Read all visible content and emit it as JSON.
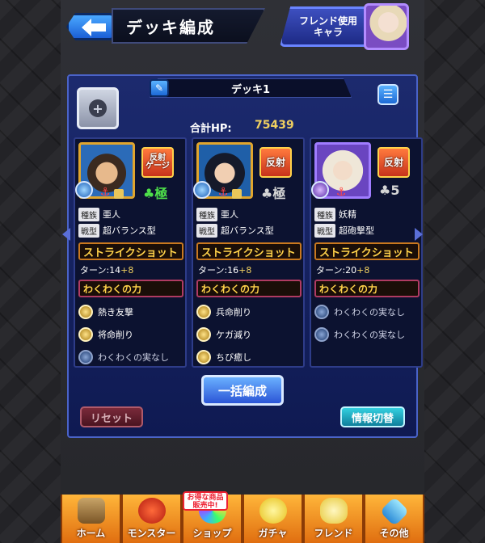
{
  "header": {
    "title": "デッキ編成",
    "friend_button_line1": "フレンド使用",
    "friend_button_line2": "キャラ"
  },
  "deck": {
    "name": "デッキ1",
    "total_hp_label": "合計HP:",
    "total_hp_value": "75439"
  },
  "cards": [
    {
      "ability_line1": "反射",
      "ability_line2": "ゲージ",
      "luck": "極",
      "tribe_tag": "種族",
      "tribe": "亜人",
      "type_tag": "戦型",
      "type": "超バランス型",
      "strike_shot": "ストライクショット",
      "turn_prefix": "ターン:14",
      "turn_plus": "+8",
      "waku_title": "わくわくの力",
      "gauges": [
        "熱き友撃",
        "将命削り",
        "わくわくの実なし"
      ]
    },
    {
      "ability_line1": "反射",
      "ability_line2": "",
      "luck": "極",
      "tribe_tag": "種族",
      "tribe": "亜人",
      "type_tag": "戦型",
      "type": "超バランス型",
      "strike_shot": "ストライクショット",
      "turn_prefix": "ターン:16",
      "turn_plus": "+8",
      "waku_title": "わくわくの力",
      "gauges": [
        "兵命削り",
        "ケガ減り",
        "ちび癒し"
      ]
    },
    {
      "ability_line1": "反射",
      "ability_line2": "",
      "luck": "5",
      "tribe_tag": "種族",
      "tribe": "妖精",
      "type_tag": "戦型",
      "type": "超砲撃型",
      "strike_shot": "ストライクショット",
      "turn_prefix": "ターン:20",
      "turn_plus": "+8",
      "waku_title": "わくわくの力",
      "gauges": [
        "わくわくの実なし",
        "わくわくの実なし"
      ]
    }
  ],
  "buttons": {
    "bulk_edit": "一括編成",
    "reset": "リセット",
    "info_toggle": "情報切替"
  },
  "nav": {
    "home": "ホーム",
    "monster": "モンスター",
    "shop": "ショップ",
    "gacha": "ガチャ",
    "friend": "フレンド",
    "other": "その他",
    "promo": "お得な商品販売中!"
  }
}
